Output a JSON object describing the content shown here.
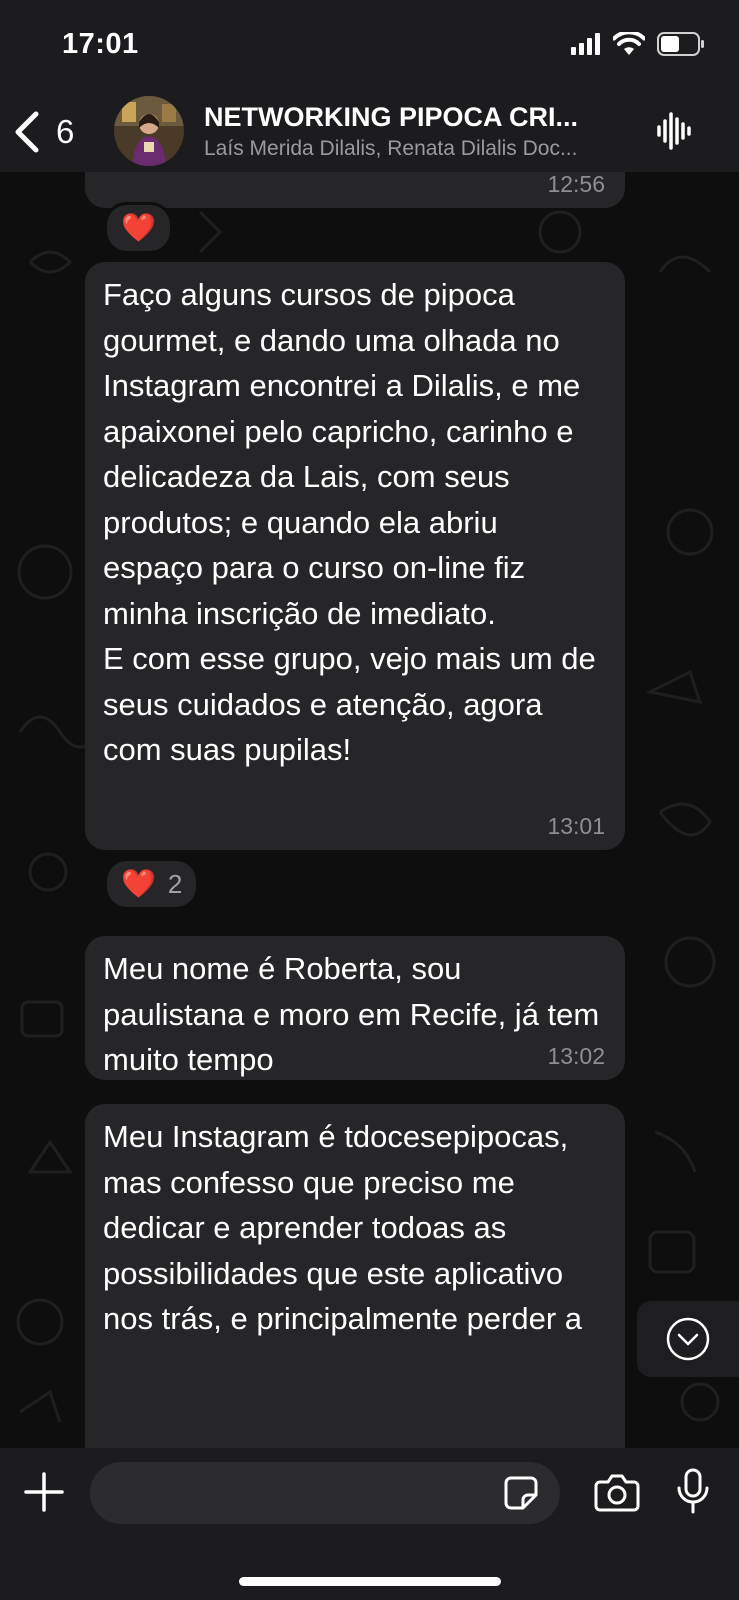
{
  "status_bar": {
    "time": "17:01",
    "battery_level": 0.5
  },
  "header": {
    "back_count": "6",
    "title": "NETWORKING PIPOCA CRI...",
    "members": "Laís Merida Dilalis, Renata Dilalis Doc..."
  },
  "colors": {
    "bubble": "#262628",
    "background": "#0b0b0b",
    "header": "#1c1c1e",
    "heart": "#e8333d",
    "timestamp": "#8e8e93"
  },
  "messages": [
    {
      "text": "",
      "time": "12:56",
      "reaction": {
        "emoji": "❤️",
        "count": ""
      }
    },
    {
      "text": "Faço alguns cursos de pipoca gourmet, e dando uma olhada no Instagram encontrei a Dilalis, e me apaixonei pelo capricho, carinho e delicadeza da Lais, com seus produtos; e quando ela abriu espaço para o curso on-line fiz minha inscrição de imediato.\nE com esse grupo, vejo mais um de seus cuidados e atenção, agora com suas pupilas!",
      "time": "13:01",
      "reaction": {
        "emoji": "❤️",
        "count": "2"
      }
    },
    {
      "text": "Meu nome é Roberta, sou paulistana e moro em Recife, já tem muito tempo",
      "time": "13:02"
    },
    {
      "text": "Meu Instagram é tdocesepipocas, mas confesso que preciso me dedicar e aprender todoas as possibilidades que este aplicativo nos trás, e principalmente perder a",
      "time": ""
    }
  ],
  "input": {
    "placeholder": "",
    "value": ""
  },
  "icons": {
    "back": "chevron-left-icon",
    "voice": "audio-waveform-icon",
    "scroll": "chevron-down-circle-icon",
    "plus": "plus-icon",
    "sticker": "sticker-icon",
    "camera": "camera-icon",
    "mic": "microphone-icon"
  }
}
